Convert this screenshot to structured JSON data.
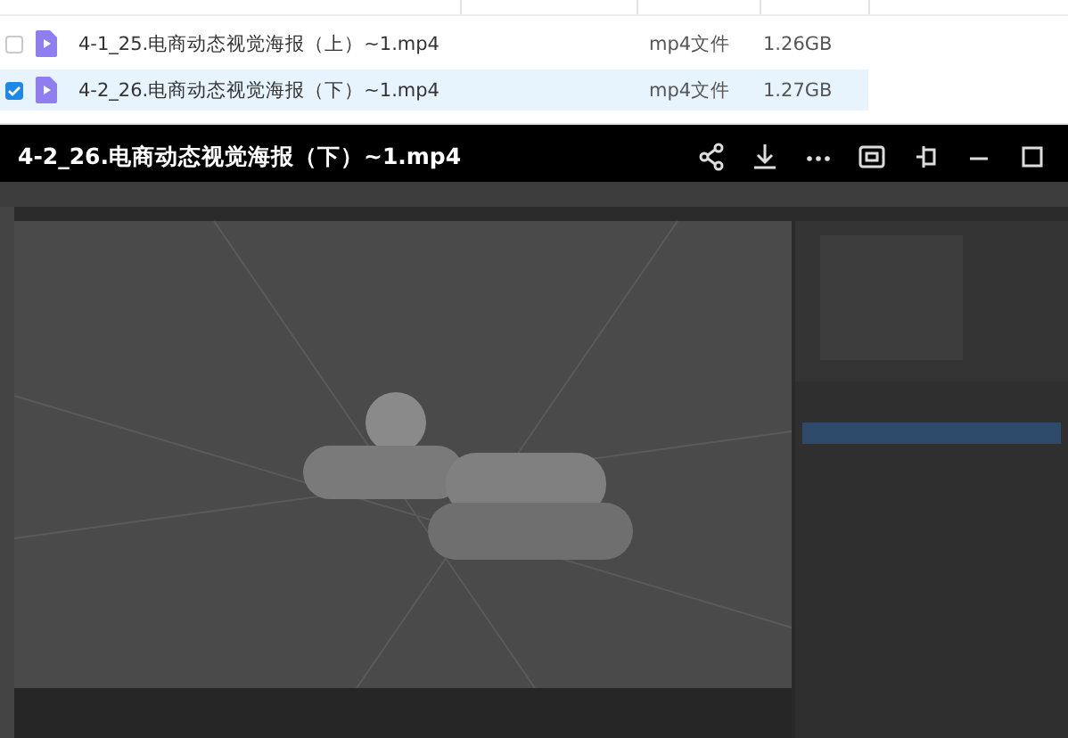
{
  "files": [
    {
      "name": "4-1_25.电商动态视觉海报（上）~1.mp4",
      "type": "mp4文件",
      "size": "1.26GB",
      "selected": false
    },
    {
      "name": "4-2_26.电商动态视觉海报（下）~1.mp4",
      "type": "mp4文件",
      "size": "1.27GB",
      "selected": true
    }
  ],
  "player": {
    "title": "4-2_26.电商动态视觉海报（下）~1.mp4"
  }
}
